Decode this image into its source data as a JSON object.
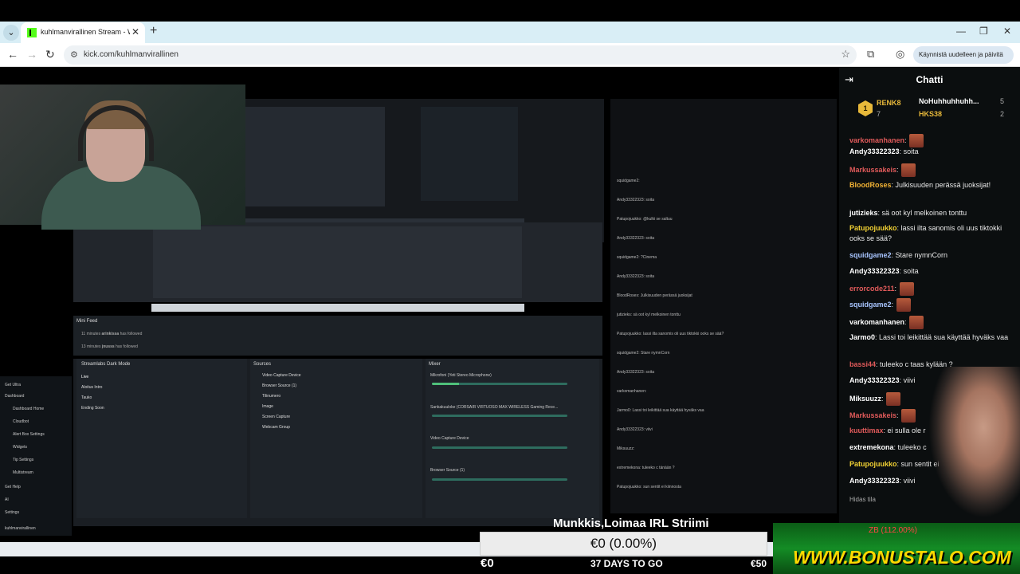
{
  "browser": {
    "tab_title": "kuhlmanvirallinen Stream - Wat",
    "url": "kick.com/kuhlmanvirallinen",
    "restart_label": "Käynnistä uudelleen ja päivitä"
  },
  "stream": {
    "overlay_title": "Munkkis,Loimaa IRL Striimi",
    "goal_value": "€0 (0.00%)",
    "goal_start": "€0",
    "goal_days": "37 DAYS TO GO",
    "goal_end": "€50",
    "sponsor": "WWW.BONUSTALO.COM",
    "sponsor_sub": "ZB (112.00%)",
    "obs": {
      "mini_feed_title": "Mini Feed",
      "feed": [
        {
          "time": "11 minutes",
          "user": "arinkissa",
          "action": "has followed"
        },
        {
          "time": "13 minutes",
          "user": "jnusss",
          "action": "has followed"
        }
      ],
      "scenes_title": "Streamlabs Dark Mode",
      "scenes": [
        "Live",
        "Aloitus Intro",
        "Tauko",
        "Ending Soon"
      ],
      "sources_title": "Sources",
      "sources": [
        "Video Capture Device",
        "Browser Source (1)",
        "Tilinumero",
        "Image",
        "Screen Capture",
        "Webcam Group"
      ],
      "mixer_title": "Mixer",
      "mixer": [
        {
          "label": "Mikrofoni (Yeti Stereo Microphone)",
          "db": "0.0 dB",
          "level": 0.2
        },
        {
          "label": "Sankakuuloke (CORSAIR VIRTUOSO MAX WIRELESS Gaming Rece...",
          "db": "0.0 dB",
          "level": 0.0
        },
        {
          "label": "Video Capture Device",
          "db": "0.0 dB",
          "level": 0.0
        },
        {
          "label": "Browser Source (1)",
          "db": "0.0 dB",
          "level": 0.0
        }
      ],
      "nav": [
        "Get Ultra",
        "Dashboard",
        "Dashboard Home",
        "Cloudbot",
        "Alert Box Settings",
        "Widgets",
        "Tip Settings",
        "Multistream",
        "Get Help",
        "AI",
        "Settings",
        "kuhlmanvirallinen"
      ]
    },
    "mini_chat": [
      "squidgame2:",
      "Andy33322323: soita",
      "Patupojuukko: @kulki se saltuu",
      "Andy33322323: soita",
      "squidgame2: ?Cinema",
      "Andy33322323: soita",
      "BloodRoses: Julkisuuden perässä juoksijat",
      "jutizieks: sä oot kyl melkoinen tonttu",
      "Patupojuukko: lassi ilta sanomis oli uus tiktokki ooks se sää?",
      "squidgame2: Stare nymnCorn",
      "Andy33322323: soita",
      "varkomanhanen:",
      "Jarmo0: Lassi toi leikittää sua käyttää hyväks vaa",
      "Andy33322323: viivi",
      "Miksuuzz:",
      "extremekona: tuleeko c tänään ?",
      "Patupojuukko: sun sentit ei kiinnosta"
    ]
  },
  "chat": {
    "title": "Chatti",
    "leaderboard": [
      {
        "rank": "1",
        "name": "RENK8",
        "count": "7",
        "color": "#e8b93a"
      },
      {
        "name": "NoHuhhuhhuhh...",
        "count": "5",
        "color": "#ffffff"
      },
      {
        "name": "HKS38",
        "count": "2",
        "color": "#e8b93a"
      }
    ],
    "messages": [
      {
        "user": "varkomanhanen",
        "color": "#e05a5a",
        "text": ""
      },
      {
        "user": "Andy33322323",
        "color": "#ffffff",
        "text": "soita"
      },
      {
        "user": "Markussakeis",
        "color": "#e05a5a",
        "text": ""
      },
      {
        "user": "BloodRoses",
        "color": "#f2b234",
        "text": "Julkisuuden perässä juoksijat!"
      },
      {
        "user": "jutizieks",
        "color": "#ffffff",
        "text": "sä oot kyl melkoinen tonttu"
      },
      {
        "user": "Patupojuukko",
        "color": "#f2d234",
        "text": "lassi ilta sanomis oli uus tiktokki ooks se sää?"
      },
      {
        "user": "squidgame2",
        "color": "#a8c5ff",
        "text": "Stare nymnCorn"
      },
      {
        "user": "Andy33322323",
        "color": "#ffffff",
        "text": "soita"
      },
      {
        "user": "errorcode211",
        "color": "#e05a5a",
        "text": ""
      },
      {
        "user": "squidgame2",
        "color": "#a8c5ff",
        "text": ""
      },
      {
        "user": "varkomanhanen",
        "color": "#ffffff",
        "text": ""
      },
      {
        "user": "Jarmo0",
        "color": "#ffffff",
        "text": "Lassi toi leikittää sua käyttää hyväks vaa"
      },
      {
        "user": "bassi44",
        "color": "#e05a5a",
        "text": "tuleeko c taas kylään ?"
      },
      {
        "user": "Andy33322323",
        "color": "#ffffff",
        "text": "viivi"
      },
      {
        "user": "Miksuuzz",
        "color": "#ffffff",
        "text": ""
      },
      {
        "user": "Markussakeis",
        "color": "#e05a5a",
        "text": ""
      },
      {
        "user": "kuuttimax",
        "color": "#e05a5a",
        "text": "ei sulla ole r"
      },
      {
        "user": "extremekona",
        "color": "#ffffff",
        "text": "tuleeko c"
      },
      {
        "user": "Patupojuukko",
        "color": "#f2d234",
        "text": "sun sentit ei"
      },
      {
        "user": "Andy33322323",
        "color": "#ffffff",
        "text": "viivi"
      }
    ],
    "slow_mode": "Hidas tila"
  },
  "colors": {
    "kick_green": "#53fc18",
    "chat_bg": "#0b0e0f"
  }
}
